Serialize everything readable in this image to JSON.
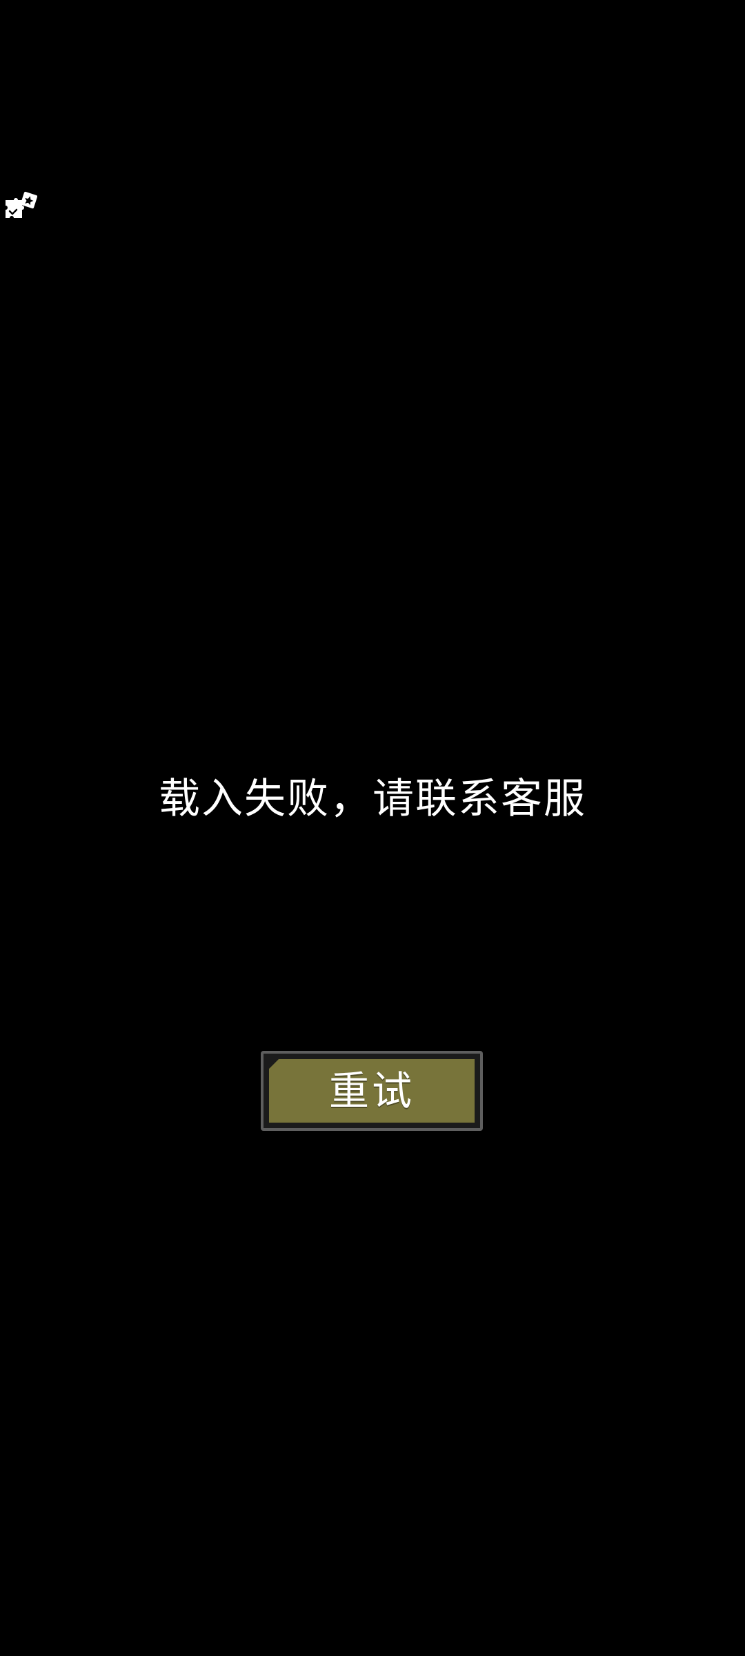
{
  "screen": {
    "background_color": "#000000",
    "plugin_icon": "puzzle-piece-icon"
  },
  "error": {
    "message": "载入失败，请联系客服"
  },
  "retry_button": {
    "label": "重试",
    "fill_color": "#78743a",
    "border_color": "#5e5e5e"
  }
}
